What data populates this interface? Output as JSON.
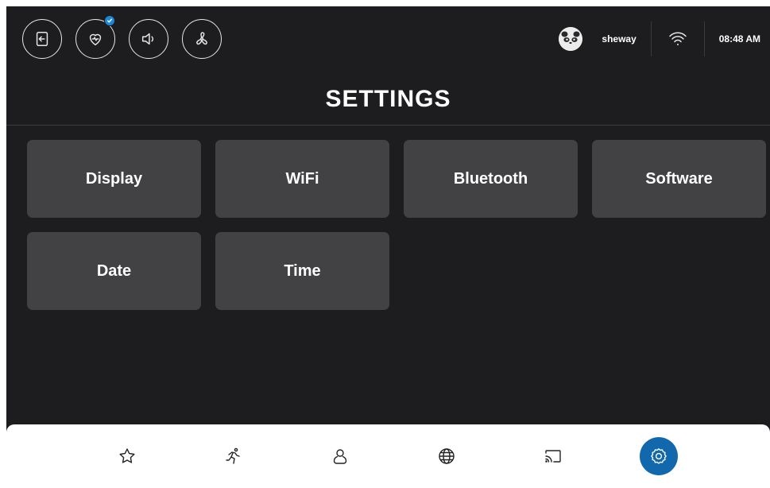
{
  "header": {
    "icons": [
      {
        "name": "exit-icon"
      },
      {
        "name": "heart-icon",
        "badge": "check-icon"
      },
      {
        "name": "speaker-icon"
      },
      {
        "name": "fan-icon"
      }
    ],
    "username": "sheway",
    "time": "08:48 AM",
    "avatar": "panda-avatar"
  },
  "page": {
    "title": "SETTINGS"
  },
  "tiles": [
    {
      "label": "Display"
    },
    {
      "label": "WiFi"
    },
    {
      "label": "Bluetooth"
    },
    {
      "label": "Software"
    },
    {
      "label": "Date"
    },
    {
      "label": "Time"
    }
  ],
  "bottom_nav": {
    "items": [
      {
        "icon": "star-icon",
        "active": false
      },
      {
        "icon": "running-icon",
        "active": false
      },
      {
        "icon": "user-icon",
        "active": false
      },
      {
        "icon": "globe-icon",
        "active": false
      },
      {
        "icon": "cast-icon",
        "active": false
      },
      {
        "icon": "gear-icon",
        "active": true
      }
    ],
    "active_color": "#1168ad"
  },
  "colors": {
    "background": "#1d1d1f",
    "tile": "#424245",
    "badge": "#1d86d8"
  }
}
